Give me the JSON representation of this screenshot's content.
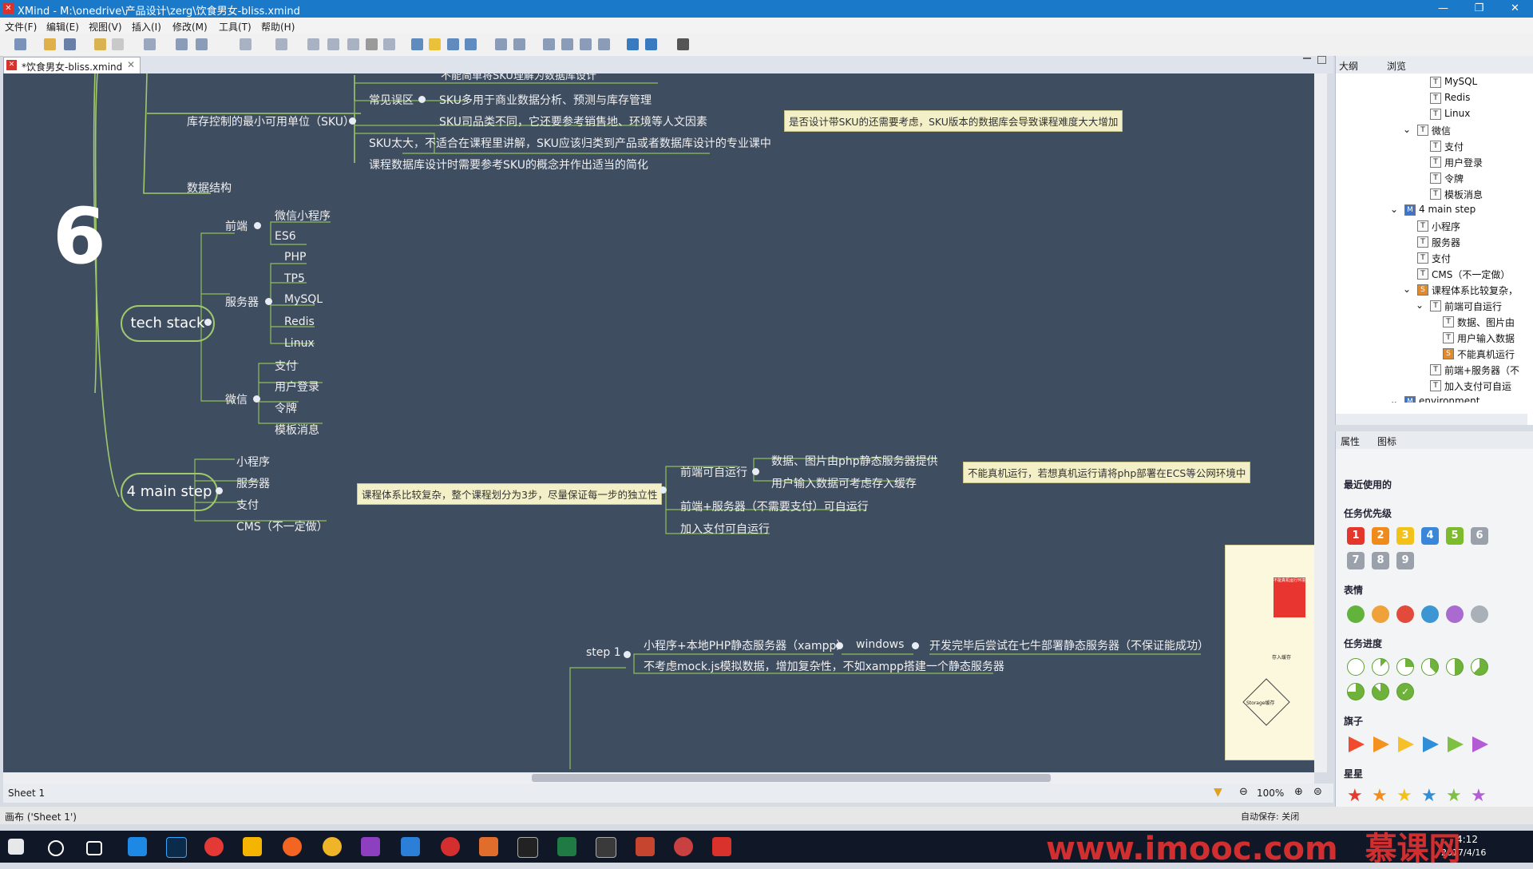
{
  "window": {
    "title": "XMind - M:\\onedrive\\产品设计\\zerg\\饮食男女-bliss.xmind",
    "controls": [
      "—",
      "❐",
      "✕"
    ]
  },
  "menu": [
    "文件(F)",
    "编辑(E)",
    "视图(V)",
    "插入(I)",
    "修改(M)",
    "工具(T)",
    "帮助(H)"
  ],
  "editor": {
    "tab": "*饮食男女-bliss.xmind",
    "sheet": "Sheet 1",
    "zoom": "100%"
  },
  "map": {
    "number": "6",
    "sku_top": "不能简单将SKU理解为数据库设计",
    "sku_parent": "库存控制的最小可用单位（SKU）",
    "sku_misunder": "常见误区",
    "sku_c1": "SKU多用于商业数据分析、预测与库存管理",
    "sku_c2": "SKU司品类不同，它还要参考销售地、环境等人文因素",
    "sku_c3": "SKU太大，不适合在课程里讲解，SKU应该归类到产品或者数据库设计的专业课中",
    "sku_c4": "课程数据库设计时需要参考SKU的概念并作出适当的简化",
    "sku_note": "是否设计带SKU的还需要考虑，SKU版本的数据库会导致课程难度大大增加",
    "data_struct": "数据结构",
    "tech": "tech stack",
    "frontend": "前端",
    "fe1": "微信小程序",
    "fe2": "ES6",
    "server": "服务器",
    "sv1": "PHP",
    "sv2": "TP5",
    "sv3": "MySQL",
    "sv4": "Redis",
    "sv5": "Linux",
    "wechat": "微信",
    "wx1": "支付",
    "wx2": "用户登录",
    "wx3": "令牌",
    "wx4": "模板消息",
    "main": "4 main step",
    "ms1": "小程序",
    "ms2": "服务器",
    "ms3": "支付",
    "ms4": "CMS（不一定做）",
    "main_note": "课程体系比较复杂，整个课程划分为3步，尽量保证每一步的独立性",
    "fe_self": "前端可自运行",
    "fe_self_c1": "数据、图片由php静态服务器提供",
    "fe_self_c2": "用户输入数据可考虑存入缓存",
    "fe_self_note": "不能真机运行，若想真机运行请将php部署在ECS等公网环境中",
    "fe_server": "前端+服务器（不需要支付）可自运行",
    "pay_self": "加入支付可自运行",
    "step1": "step 1",
    "step1_c1": "小程序+本地PHP静态服务器（xampp）",
    "windows": "windows",
    "step1_c1b": "开发完毕后尝试在七牛部署静态服务器（不保证能成功）",
    "step1_c2": "不考虑mock.js模拟数据，增加复杂性，不如xampp搭建一个静态服务器",
    "diagram_storage": "Storage缓存",
    "diagram_in": "存入缓存",
    "diagram_red": "不能真机运行环境"
  },
  "outline": {
    "tabs": [
      "大纲",
      "浏览"
    ],
    "rows": [
      {
        "label": "MySQL",
        "indent": 3,
        "icon": "T"
      },
      {
        "label": "Redis",
        "indent": 3,
        "icon": "T"
      },
      {
        "label": "Linux",
        "indent": 3,
        "icon": "T"
      },
      {
        "label": "微信",
        "indent": 2,
        "icon": "T",
        "expand": "⌄"
      },
      {
        "label": "支付",
        "indent": 3,
        "icon": "T"
      },
      {
        "label": "用户登录",
        "indent": 3,
        "icon": "T"
      },
      {
        "label": "令牌",
        "indent": 3,
        "icon": "T"
      },
      {
        "label": "模板消息",
        "indent": 3,
        "icon": "T"
      },
      {
        "label": "4 main step",
        "indent": 1,
        "icon": "M",
        "expand": "⌄"
      },
      {
        "label": "小程序",
        "indent": 2,
        "icon": "T"
      },
      {
        "label": "服务器",
        "indent": 2,
        "icon": "T"
      },
      {
        "label": "支付",
        "indent": 2,
        "icon": "T"
      },
      {
        "label": "CMS（不一定做）",
        "indent": 2,
        "icon": "T"
      },
      {
        "label": "课程体系比较复杂，",
        "indent": 2,
        "icon": "S",
        "expand": "⌄"
      },
      {
        "label": "前端可自运行",
        "indent": 3,
        "icon": "T",
        "expand": "⌄"
      },
      {
        "label": "数据、图片由",
        "indent": 4,
        "icon": "T"
      },
      {
        "label": "用户输入数据",
        "indent": 4,
        "icon": "T"
      },
      {
        "label": "不能真机运行",
        "indent": 4,
        "icon": "S"
      },
      {
        "label": "前端+服务器（不",
        "indent": 3,
        "icon": "T"
      },
      {
        "label": "加入支付可自运",
        "indent": 3,
        "icon": "T"
      },
      {
        "label": "environment",
        "indent": 1,
        "icon": "M",
        "expand": "⌄"
      }
    ]
  },
  "props": {
    "tabs": [
      "属性",
      "图标"
    ],
    "sections": [
      "最近使用的",
      "任务优先级",
      "表情",
      "任务进度",
      "旗子",
      "星星"
    ],
    "priorities": [
      "1",
      "2",
      "3",
      "4",
      "5",
      "6",
      "7",
      "8",
      "9"
    ],
    "priority_colors": [
      "#e3362d",
      "#ef8a1d",
      "#f2c21b",
      "#3a87d9",
      "#7dbb2c",
      "#9aa1ab",
      "#9aa1ab",
      "#9aa1ab",
      "#9aa1ab"
    ],
    "flag_colors": [
      "#ef4b2c",
      "#f5921f",
      "#f6c02b",
      "#2f8ed8",
      "#7ec142",
      "#b45bd6"
    ],
    "star_colors": [
      "#e63a2d",
      "#f38c1f",
      "#f2c21b",
      "#2f8ed8",
      "#7ec142",
      "#b45bd6"
    ]
  },
  "status": {
    "left": "画布 ('Sheet 1')",
    "autosave": "自动保存: 关闭"
  },
  "taskbar": {
    "clock_time": "4:12",
    "clock_date": "2017/4/16",
    "watermark": "www.imooc.com",
    "watermark2": "慕课网"
  }
}
